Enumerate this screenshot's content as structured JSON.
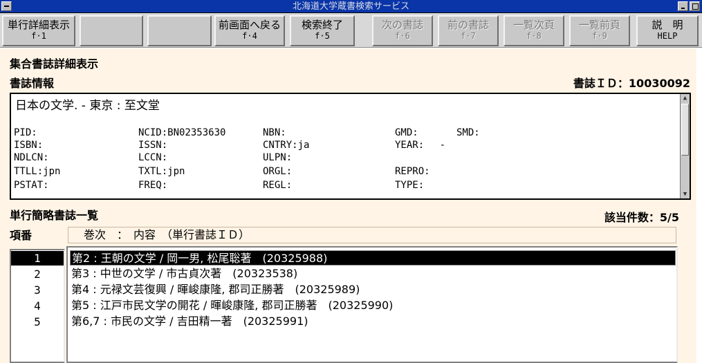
{
  "window": {
    "title": "北海道大学蔵書検索サービス"
  },
  "toolbar": {
    "buttons": [
      {
        "label": "単行詳細表示",
        "key": "f·1",
        "enabled": true
      },
      {
        "label": "",
        "key": "",
        "enabled": true
      },
      {
        "label": "",
        "key": "",
        "enabled": true
      },
      {
        "label": "前画面へ戻る",
        "key": "f·4",
        "enabled": true
      },
      {
        "label": "検索終了",
        "key": "f·5",
        "enabled": true
      },
      {
        "label": "次の書誌",
        "key": "f·6",
        "enabled": false
      },
      {
        "label": "前の書誌",
        "key": "f·7",
        "enabled": false
      },
      {
        "label": "一覧次頁",
        "key": "f·8",
        "enabled": false
      },
      {
        "label": "一覧前頁",
        "key": "f·9",
        "enabled": false
      },
      {
        "label": "説　明",
        "key": "HELP",
        "enabled": true
      }
    ]
  },
  "main": {
    "screen_title": "集合書誌詳細表示",
    "biblio_section_label": "書誌情報",
    "biblio_id": "書誌ＩＤ：10030092",
    "biblio": {
      "title_line": "日本の文学. - 東京 : 至文堂",
      "fields": {
        "pid": "PID:",
        "ncid": "NCID:BN02353630",
        "nbn": "NBN:",
        "gmd": "GMD:",
        "smd": "SMD:",
        "isbn": "ISBN:",
        "issn": "ISSN:",
        "cntry": "CNTRY:ja",
        "year": "YEAR:　 -",
        "ndlcn": "NDLCN:",
        "lccn": "LCCN:",
        "ulpn": "ULPN:",
        "ttll": "TTLL:jpn",
        "txtl": "TXTL:jpn",
        "orgl": "ORGL:",
        "repro": "REPRO:",
        "pstat": "PSTAT:",
        "freq": "FREQ:",
        "regl": "REGL:",
        "type": "TYPE:"
      }
    },
    "list_section_label": "単行簡略書誌一覧",
    "hit_count": "該当件数：5/5",
    "index_header": "項番",
    "column_header": "巻次　：　内容　（単行書誌ＩＤ）",
    "rows": [
      {
        "index": "1",
        "text": "第2 : 王朝の文学 / 岡一男, 松尾聡著　(20325988)"
      },
      {
        "index": "2",
        "text": "第3 : 中世の文学 / 市古貞次著　(20323538)"
      },
      {
        "index": "3",
        "text": "第4 : 元禄文芸復興 / 暉峻康隆, 郡司正勝著　(20325989)"
      },
      {
        "index": "4",
        "text": "第5 : 江戸市民文学の開花 / 暉峻康隆, 郡司正勝著　(20325990)"
      },
      {
        "index": "5",
        "text": "第6,7 : 市民の文学 / 吉田精一著　(20325991)"
      }
    ],
    "selected_row": 1
  }
}
